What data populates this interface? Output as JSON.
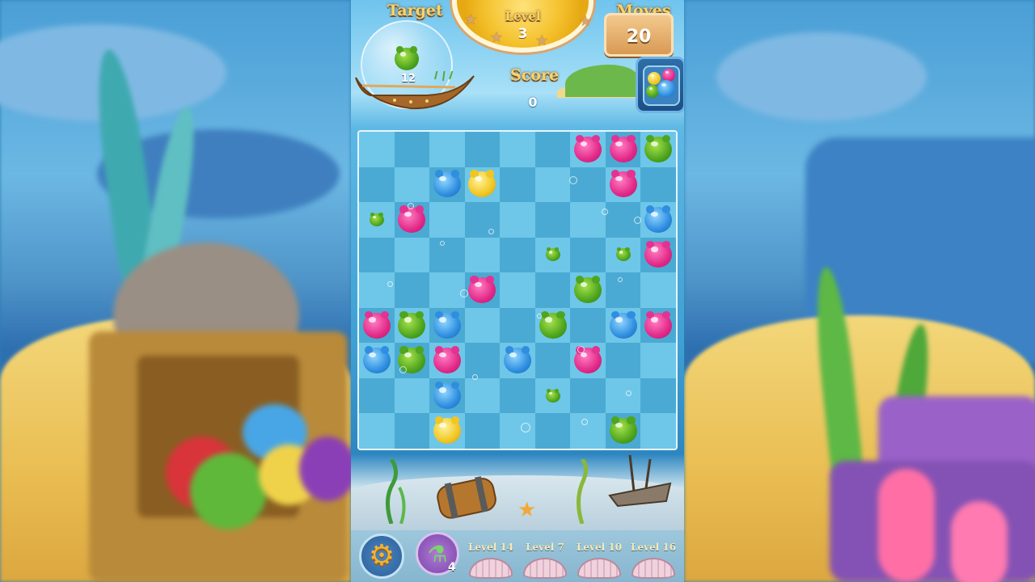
{
  "hud": {
    "target_label": "Target",
    "target_count": "12",
    "target_piece": "green",
    "level_label": "Level",
    "level_number": "3",
    "moves_label": "Moves",
    "moves_value": "20",
    "score_label": "Score",
    "score_value": "0"
  },
  "board": {
    "rows": 9,
    "cols": 9,
    "pieces": [
      {
        "row": 0,
        "col": 6,
        "color": "pink",
        "size": "large"
      },
      {
        "row": 0,
        "col": 7,
        "color": "pink",
        "size": "large"
      },
      {
        "row": 0,
        "col": 8,
        "color": "green",
        "size": "large"
      },
      {
        "row": 1,
        "col": 2,
        "color": "blue",
        "size": "large"
      },
      {
        "row": 1,
        "col": 3,
        "color": "yellow",
        "size": "large"
      },
      {
        "row": 1,
        "col": 7,
        "color": "pink",
        "size": "large"
      },
      {
        "row": 2,
        "col": 0,
        "color": "green",
        "size": "small"
      },
      {
        "row": 2,
        "col": 1,
        "color": "pink",
        "size": "large"
      },
      {
        "row": 2,
        "col": 8,
        "color": "blue",
        "size": "large"
      },
      {
        "row": 3,
        "col": 5,
        "color": "green",
        "size": "small"
      },
      {
        "row": 3,
        "col": 7,
        "color": "green",
        "size": "small"
      },
      {
        "row": 3,
        "col": 8,
        "color": "pink",
        "size": "large"
      },
      {
        "row": 4,
        "col": 3,
        "color": "pink",
        "size": "large"
      },
      {
        "row": 4,
        "col": 6,
        "color": "green",
        "size": "large"
      },
      {
        "row": 5,
        "col": 0,
        "color": "pink",
        "size": "large"
      },
      {
        "row": 5,
        "col": 1,
        "color": "green",
        "size": "large"
      },
      {
        "row": 5,
        "col": 2,
        "color": "blue",
        "size": "large"
      },
      {
        "row": 5,
        "col": 5,
        "color": "green",
        "size": "large"
      },
      {
        "row": 5,
        "col": 7,
        "color": "blue",
        "size": "large"
      },
      {
        "row": 5,
        "col": 8,
        "color": "pink",
        "size": "large"
      },
      {
        "row": 6,
        "col": 0,
        "color": "blue",
        "size": "large"
      },
      {
        "row": 6,
        "col": 1,
        "color": "green",
        "size": "large"
      },
      {
        "row": 6,
        "col": 2,
        "color": "pink",
        "size": "large"
      },
      {
        "row": 6,
        "col": 4,
        "color": "blue",
        "size": "large"
      },
      {
        "row": 6,
        "col": 6,
        "color": "pink",
        "size": "large"
      },
      {
        "row": 7,
        "col": 2,
        "color": "blue",
        "size": "large"
      },
      {
        "row": 7,
        "col": 5,
        "color": "green",
        "size": "small"
      },
      {
        "row": 8,
        "col": 2,
        "color": "yellow",
        "size": "large"
      },
      {
        "row": 8,
        "col": 7,
        "color": "green",
        "size": "large"
      }
    ]
  },
  "bottom_bar": {
    "settings_icon": "gear-icon",
    "potion_icon": "potion-icon",
    "potion_count": "4",
    "level_slots": [
      {
        "label": "Level 14"
      },
      {
        "label": "Level 7"
      },
      {
        "label": "Level 10"
      },
      {
        "label": "Level 16"
      }
    ]
  },
  "colors": {
    "pink": "#e22988",
    "green": "#4ea51e",
    "blue": "#2f8ee0",
    "yellow": "#f1c623",
    "title_gold": "#f7d36a"
  }
}
